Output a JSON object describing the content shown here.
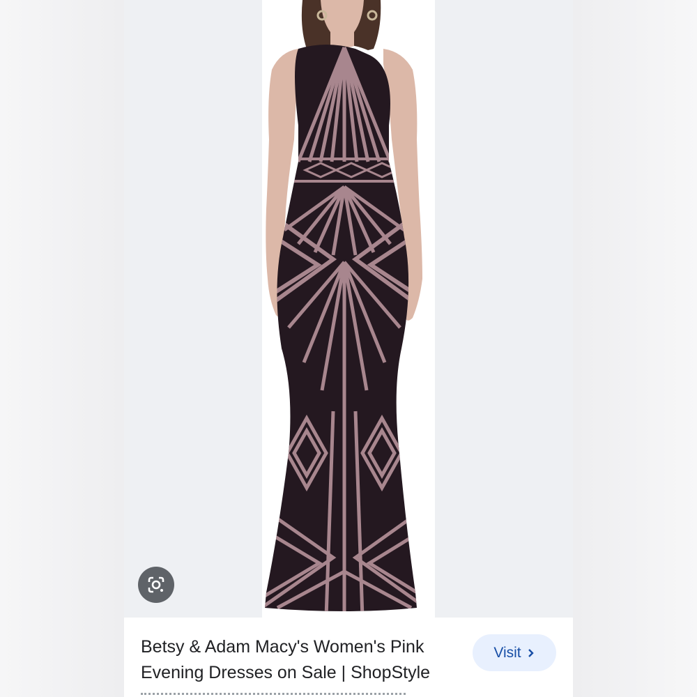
{
  "result": {
    "title": "Betsy & Adam Macy's Women's Pink Evening Dresses on Sale | ShopStyle",
    "visit_label": "Visit"
  },
  "icons": {
    "lens": "google-lens-icon",
    "visit_arrow": "chevron-right-icon"
  },
  "colors": {
    "dress_base": "#241820",
    "dress_stripe": "#a8868e",
    "skin": "#dcb8a8",
    "hair": "#4a3228",
    "visit_button_bg": "#e8f0fe",
    "visit_text": "#174ea6",
    "lens_button_bg": "#5f6368"
  }
}
